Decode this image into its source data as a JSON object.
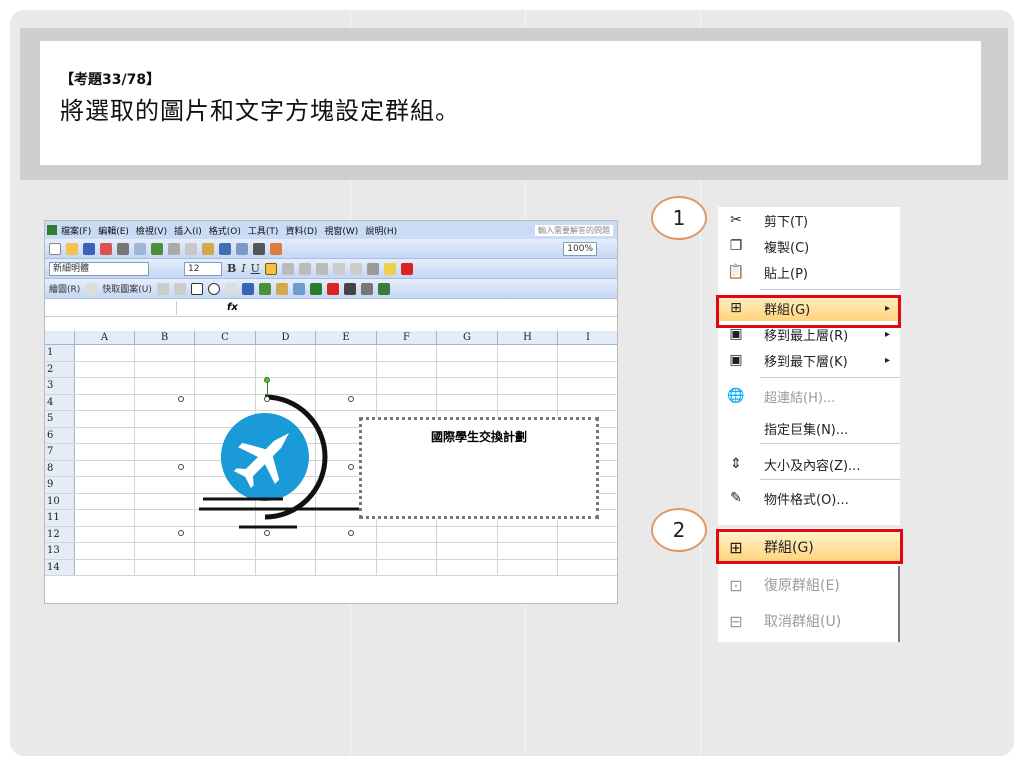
{
  "question": {
    "number": "【考題33/78】",
    "text": "將選取的圖片和文字方塊設定群組。"
  },
  "excel": {
    "menu": [
      "檔案(F)",
      "編輯(E)",
      "檢視(V)",
      "插入(I)",
      "格式(O)",
      "工具(T)",
      "資料(D)",
      "視窗(W)",
      "說明(H)"
    ],
    "help_box": "輸入需要解答的問題",
    "font_name": "新細明體",
    "font_size": "12",
    "zoom": "100%",
    "drawing_label": "繪圖(R)",
    "autoshape_label": "快取圖案(U)",
    "fx": "fx",
    "columns": [
      "A",
      "B",
      "C",
      "D",
      "E",
      "F",
      "G",
      "H",
      "I"
    ],
    "rows": [
      "1",
      "2",
      "3",
      "4",
      "5",
      "6",
      "7",
      "8",
      "9",
      "10",
      "11",
      "12",
      "13",
      "14"
    ],
    "textbox_text": "國際學生交換計劃",
    "bold_label": "B",
    "italic_label": "I",
    "underline_label": "U"
  },
  "steps": [
    "1",
    "2"
  ],
  "context_menu": {
    "items": [
      {
        "icon": "scissors-icon",
        "glyph": "✂",
        "label": "剪下(T)",
        "disabled": false
      },
      {
        "icon": "copy-icon",
        "glyph": "❐",
        "label": "複製(C)",
        "disabled": false
      },
      {
        "icon": "paste-icon",
        "glyph": "📋",
        "label": "貼上(P)",
        "disabled": false
      },
      {
        "icon": "group-icon",
        "glyph": "⊞",
        "label": "群組(G)",
        "disabled": false,
        "submenu": true,
        "highlighted": true
      },
      {
        "icon": "bring-front-icon",
        "glyph": "▣",
        "label": "移到最上層(R)",
        "disabled": false,
        "submenu": true
      },
      {
        "icon": "send-back-icon",
        "glyph": "▣",
        "label": "移到最下層(K)",
        "disabled": false,
        "submenu": true
      },
      {
        "icon": "hyperlink-icon",
        "glyph": "🌐",
        "label": "超連結(H)...",
        "disabled": true
      },
      {
        "icon": "",
        "glyph": "",
        "label": "指定巨集(N)...",
        "disabled": false
      },
      {
        "icon": "size-icon",
        "glyph": "⇕",
        "label": "大小及內容(Z)...",
        "disabled": false
      },
      {
        "icon": "format-object-icon",
        "glyph": "✎",
        "label": "物件格式(O)...",
        "disabled": false
      }
    ]
  },
  "submenu": {
    "items": [
      {
        "icon": "group-icon",
        "glyph": "⊞",
        "label": "群組(G)",
        "disabled": false,
        "highlighted": true
      },
      {
        "icon": "regroup-icon",
        "glyph": "⊡",
        "label": "復原群組(E)",
        "disabled": true
      },
      {
        "icon": "ungroup-icon",
        "glyph": "⊟",
        "label": "取消群組(U)",
        "disabled": true
      }
    ]
  },
  "colors": {
    "airplane_circle": "#1a9ad6",
    "highlight_border": "#e30613",
    "step_border": "#e09a6a"
  }
}
